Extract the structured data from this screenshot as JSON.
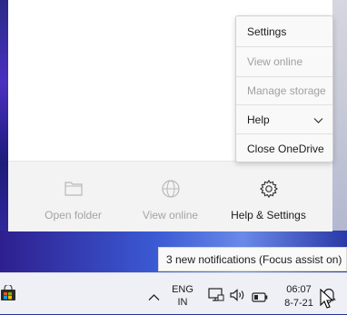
{
  "flyout": {
    "footer": {
      "open_folder": "Open folder",
      "view_online": "View online",
      "help_settings": "Help & Settings"
    }
  },
  "menu": {
    "settings": "Settings",
    "view_online": "View online",
    "manage_storage": "Manage storage",
    "help": "Help",
    "close_onedrive": "Close OneDrive"
  },
  "notification": {
    "text": "3 new notifications (Focus assist on)"
  },
  "taskbar": {
    "language_line1": "ENG",
    "language_line2": "IN",
    "time": "06:07",
    "date": "8-7-21"
  },
  "icons": {
    "store": "store-icon",
    "chevron_up": "chevron-up-icon",
    "network": "network-icon",
    "volume": "volume-icon",
    "battery": "battery-icon",
    "notifications": "notifications-icon"
  },
  "colors": {
    "accent_blue": "#2a3bc2",
    "disabled_text": "#a0a0a0"
  }
}
